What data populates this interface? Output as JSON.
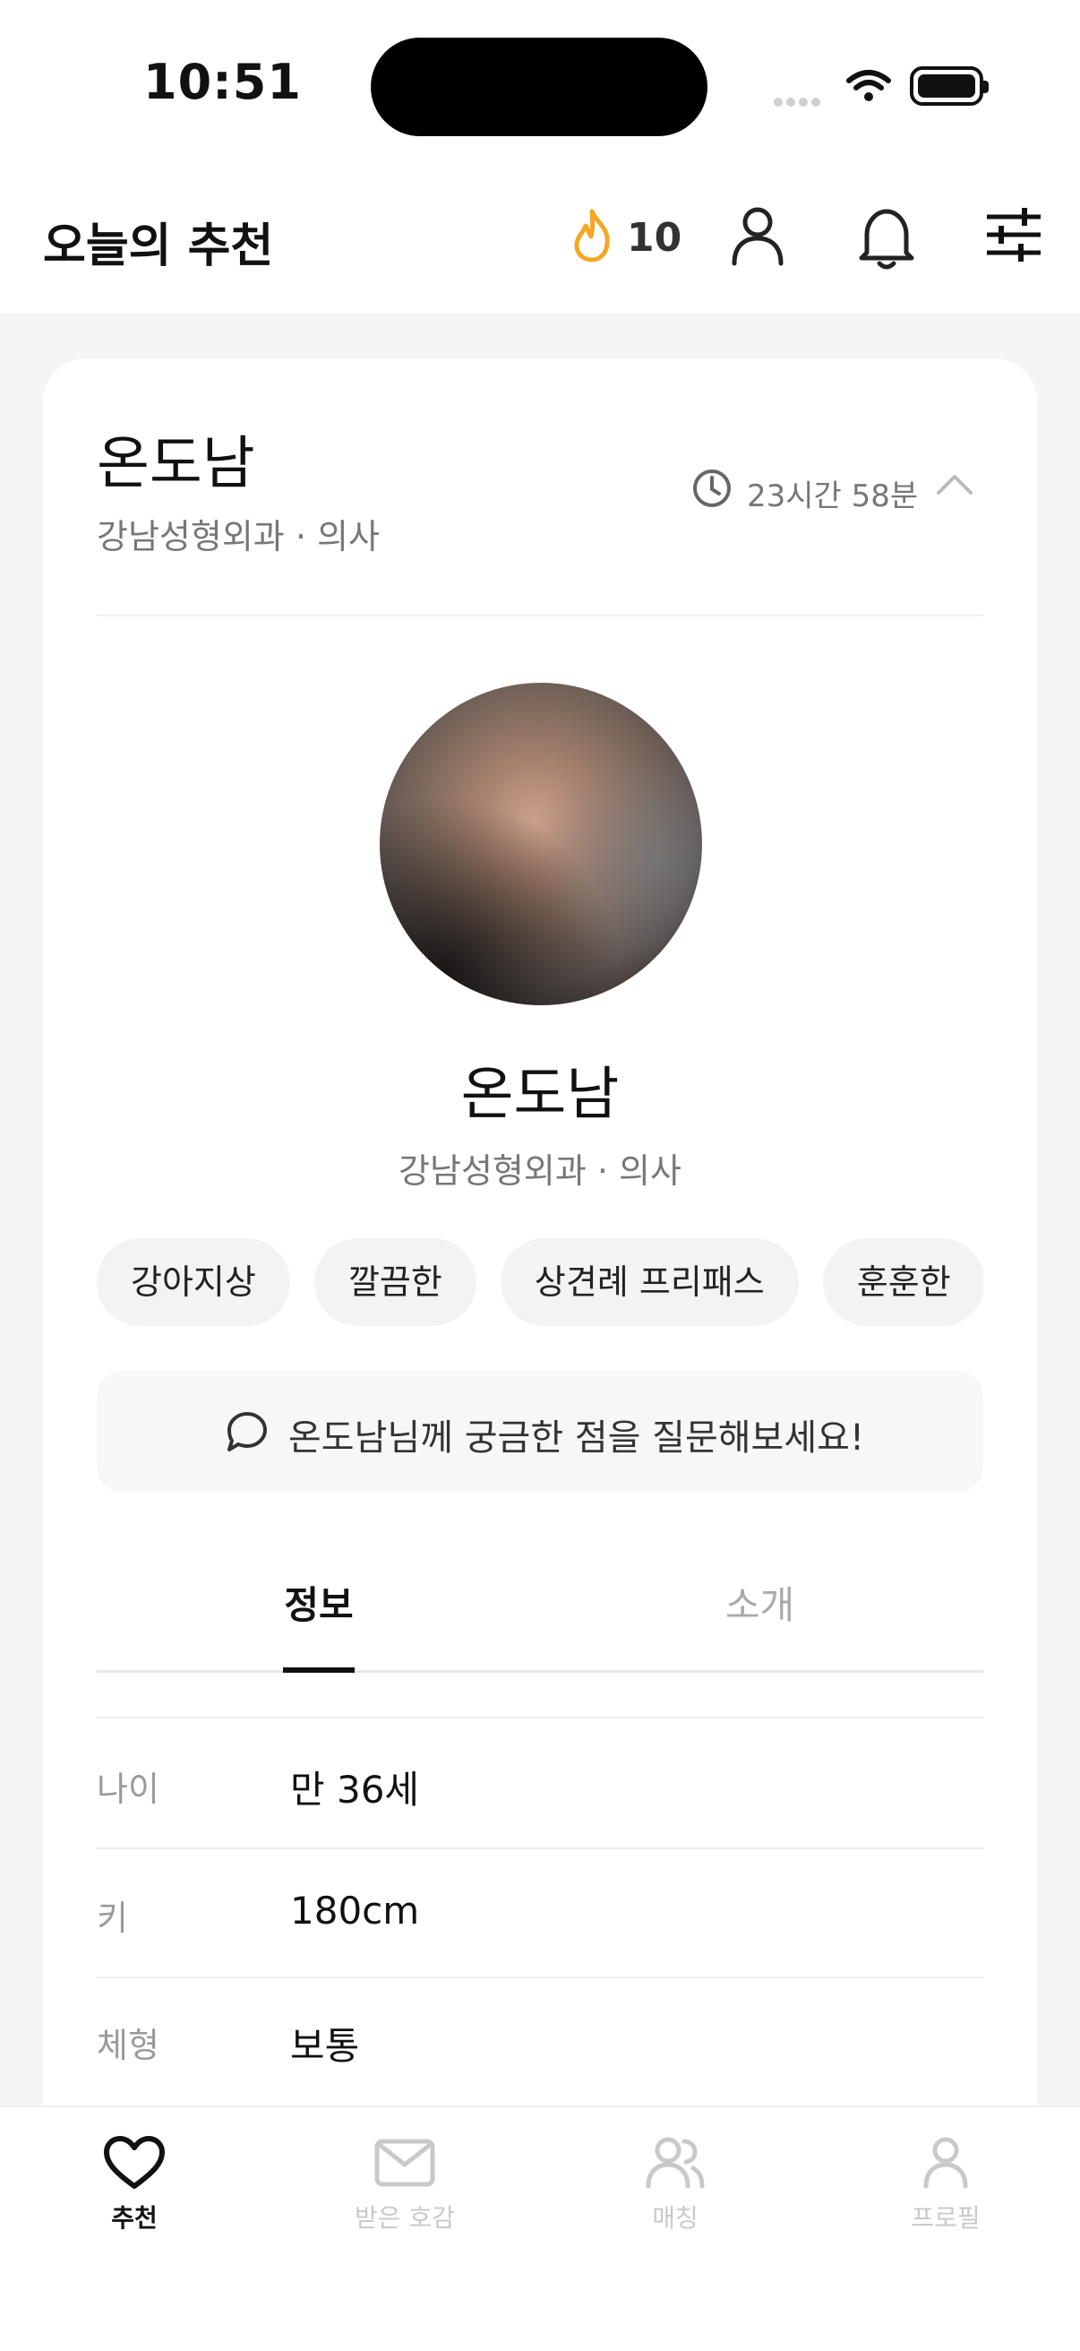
{
  "status_bar": {
    "time": "10:51"
  },
  "header": {
    "title": "오늘의 추천",
    "fire_count": "10",
    "icons": [
      "fire-icon",
      "person-icon",
      "bell-icon",
      "sliders-icon"
    ]
  },
  "card": {
    "name": "온도남",
    "subtitle": "강남성형외과 · 의사",
    "timer": "23시간 58분",
    "profile_name": "온도남",
    "profile_subtitle": "강남성형외과 · 의사",
    "chips": [
      "강아지상",
      "깔끔한",
      "상견례 프리패스",
      "훈훈한"
    ],
    "ask_text": "온도남님께 궁금한 점을 질문해보세요!",
    "tabs": [
      {
        "label": "정보",
        "active": true
      },
      {
        "label": "소개",
        "active": false
      }
    ],
    "info_rows": [
      {
        "label": "나이",
        "value": "만 36세"
      },
      {
        "label": "키",
        "value": "180cm"
      },
      {
        "label": "체형",
        "value": "보통"
      }
    ]
  },
  "bottom_nav": [
    {
      "label": "추천",
      "icon": "heart-icon",
      "active": true
    },
    {
      "label": "받은 호감",
      "icon": "mail-icon",
      "active": false
    },
    {
      "label": "매칭",
      "icon": "people-icon",
      "active": false
    },
    {
      "label": "프로필",
      "icon": "person-icon",
      "active": false
    }
  ],
  "colors": {
    "accent_fire": "#f5a623",
    "text_primary": "#111111",
    "text_muted": "#777777",
    "inactive": "#c9c9c9"
  }
}
